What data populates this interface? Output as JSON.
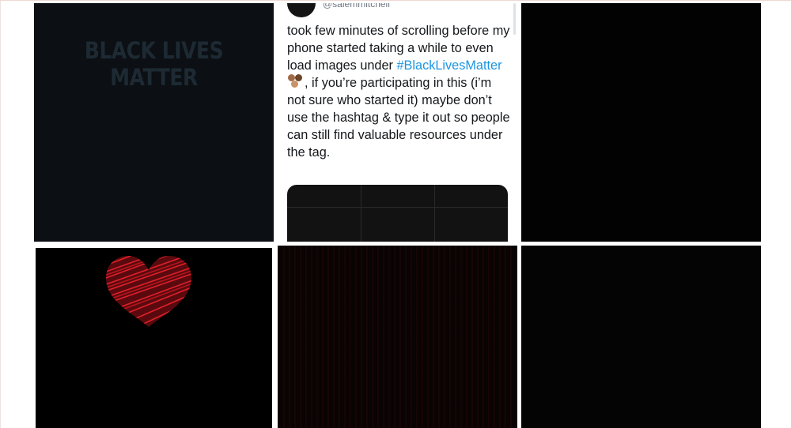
{
  "gallery": {
    "tile1": {
      "text": "BLACK LIVES MATTER"
    },
    "tweet": {
      "handle": "@salemmitchell",
      "text_part1": "took few minutes of scrolling before my phone started taking a while to even load images under ",
      "hashtag": "#BlackLivesMatter",
      "text_part2": ", if you’re participating in this (i’m not sure who started it) maybe don’t use the hashtag & type it out so people can still find valuable resources under the tag."
    }
  },
  "colors": {
    "hashtag": "#1b95e0",
    "heart": "#c8141e",
    "blm_text": "#1d2a33"
  }
}
